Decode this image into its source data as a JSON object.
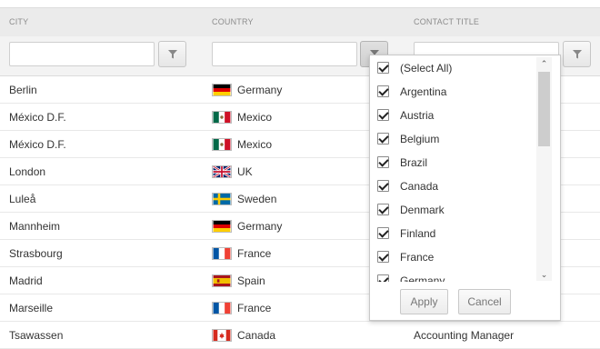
{
  "header": {
    "columns": [
      "City",
      "Country",
      "Contact Title"
    ]
  },
  "rows": [
    {
      "city": "Berlin",
      "country": "Germany",
      "flag": "de",
      "title": ""
    },
    {
      "city": "México D.F.",
      "country": "Mexico",
      "flag": "mx",
      "title": ""
    },
    {
      "city": "México D.F.",
      "country": "Mexico",
      "flag": "mx",
      "title": ""
    },
    {
      "city": "London",
      "country": "UK",
      "flag": "gb",
      "title": ""
    },
    {
      "city": "Luleå",
      "country": "Sweden",
      "flag": "se",
      "title": ""
    },
    {
      "city": "Mannheim",
      "country": "Germany",
      "flag": "de",
      "title": ""
    },
    {
      "city": "Strasbourg",
      "country": "France",
      "flag": "fr",
      "title": ""
    },
    {
      "city": "Madrid",
      "country": "Spain",
      "flag": "es",
      "title": ""
    },
    {
      "city": "Marseille",
      "country": "France",
      "flag": "fr",
      "title": ""
    },
    {
      "city": "Tsawassen",
      "country": "Canada",
      "flag": "ca",
      "title": "Accounting Manager"
    }
  ],
  "filter_menu": {
    "items": [
      {
        "label": "(Select All)",
        "checked": true
      },
      {
        "label": "Argentina",
        "checked": true
      },
      {
        "label": "Austria",
        "checked": true
      },
      {
        "label": "Belgium",
        "checked": true
      },
      {
        "label": "Brazil",
        "checked": true
      },
      {
        "label": "Canada",
        "checked": true
      },
      {
        "label": "Denmark",
        "checked": true
      },
      {
        "label": "Finland",
        "checked": true
      },
      {
        "label": "France",
        "checked": true
      },
      {
        "label": "Germany",
        "checked": true
      }
    ],
    "apply_label": "Apply",
    "cancel_label": "Cancel"
  },
  "icons": {
    "filter": "filter-funnel-icon",
    "scroll_up": "chevron-up-icon",
    "scroll_down": "chevron-down-icon",
    "checkbox": "checkmark-icon"
  },
  "colors": {
    "header_bg": "#ebebeb",
    "filter_row_bg": "#f3f3f3",
    "text": "#333333",
    "header_text": "#8c8c8c"
  }
}
